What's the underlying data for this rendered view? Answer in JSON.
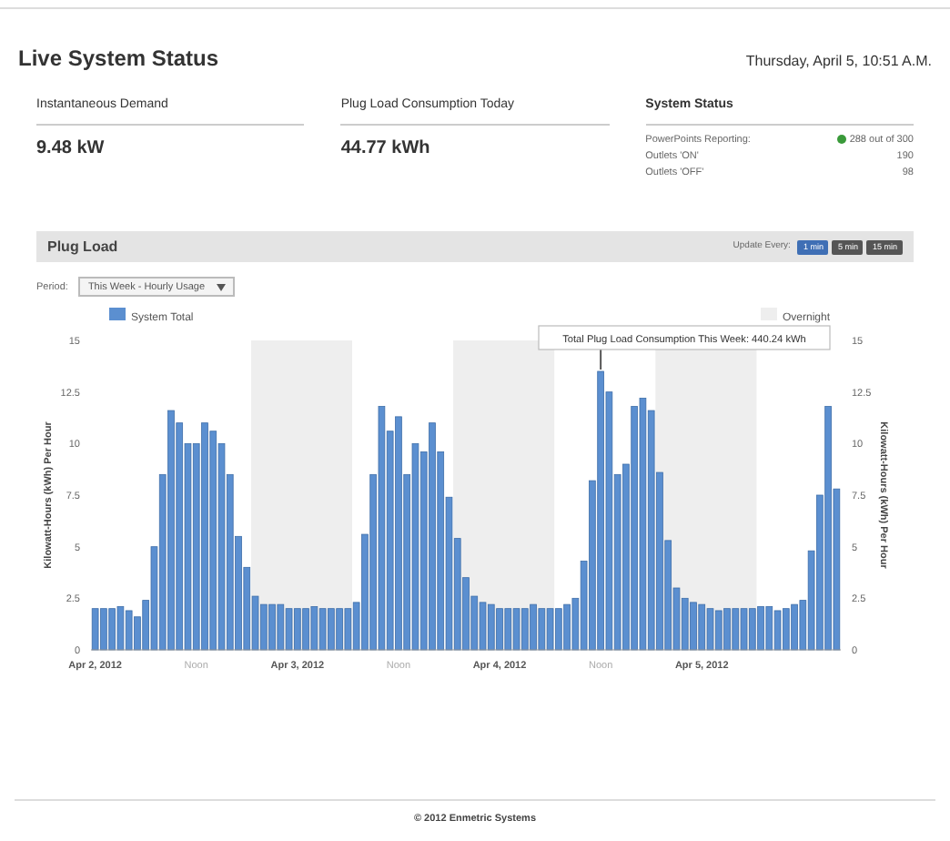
{
  "header": {
    "title": "Live System Status",
    "datetime": "Thursday, April 5, 10:51 A.M."
  },
  "summary": [
    {
      "label": "Instantaneous Demand",
      "value": "9.48 kW"
    },
    {
      "label": "Plug Load Consumption Today",
      "value": "44.77 kWh"
    }
  ],
  "system_status": {
    "label": "System Status",
    "rows": [
      {
        "label": "PowerPoints Reporting:",
        "value": "288 out of 300",
        "color": "#3a9a3a"
      },
      {
        "label": "Outlets 'ON'",
        "value": "190"
      },
      {
        "label": "Outlets 'OFF'",
        "value": "98"
      }
    ]
  },
  "panel": {
    "title": "Plug Load",
    "update_label": "Update Every:",
    "update_buttons": [
      {
        "label": "1 min",
        "selected": true
      },
      {
        "label": "5 min",
        "selected": false
      },
      {
        "label": "15 min",
        "selected": false
      }
    ],
    "period_label": "Period:",
    "period_value": "This Week - Hourly Usage",
    "legend": [
      {
        "label": "Overnight",
        "kind": "band",
        "color": "#eeeeee"
      }
    ],
    "tooltip": "Total Plug Load Consumption This Week: 440.24 kWh",
    "right_ylabel": "Kilowatt-Hours (kWh) Per Hour",
    "right_yticks": [
      "15",
      "12.5",
      "10",
      "7.5",
      "5",
      "2.5",
      "0"
    ],
    "chart_data": {
      "type": "bar",
      "ylabel": "Kilowatt-Hours (kWh) Per Hour",
      "categories": [
        "Apr 2, 2012",
        null,
        null,
        null,
        null,
        null,
        null,
        null,
        null,
        null,
        null,
        null,
        "Noon",
        null,
        null,
        null,
        null,
        null,
        null,
        null,
        null,
        null,
        null,
        null,
        "Apr 3, 2012",
        null,
        null,
        null,
        null,
        null,
        null,
        null,
        null,
        null,
        null,
        null,
        "Noon",
        null,
        null,
        null,
        null,
        null,
        null,
        null,
        null,
        null,
        null,
        null,
        "Apr 4, 2012",
        null,
        null,
        null,
        null,
        null,
        null,
        null,
        null,
        null,
        null,
        null,
        "Noon",
        null,
        null,
        null,
        null,
        null,
        null,
        null,
        null,
        null,
        null,
        null,
        "Apr 5, 2012",
        null,
        null,
        null,
        null,
        null,
        null,
        null,
        null,
        null,
        null,
        null,
        null,
        null,
        null,
        null,
        null
      ],
      "series": [
        {
          "name": "System Total",
          "color": "#5b8fd0",
          "values": [
            2,
            2,
            2,
            2.1,
            1.9,
            1.6,
            2.4,
            5,
            8.5,
            11.6,
            11,
            10,
            10,
            11,
            10.6,
            10,
            8.5,
            5.5,
            4,
            2.6,
            2.2,
            2.2,
            2.2,
            2,
            2,
            2,
            2.1,
            2,
            2,
            2,
            2,
            2.3,
            5.6,
            8.5,
            11.8,
            10.6,
            11.3,
            8.5,
            10,
            9.6,
            11,
            9.6,
            7.4,
            5.4,
            3.5,
            2.6,
            2.3,
            2.2,
            2,
            2,
            2,
            2,
            2.2,
            2,
            2,
            2,
            2.2,
            2.5,
            4.3,
            8.2,
            13.5,
            12.5,
            8.5,
            9,
            11.8,
            12.2,
            11.6,
            8.6,
            5.3,
            3,
            2.5,
            2.3,
            2.2,
            2,
            1.9,
            2,
            2,
            2,
            2,
            2.1,
            2.1,
            1.9,
            2,
            2.2,
            2.4,
            4.8,
            7.5,
            11.8,
            7.8
          ]
        }
      ],
      "ylim": [
        0,
        15
      ],
      "yticks": [
        0,
        {
          "value": 2.5,
          "label": "2.5"
        },
        5,
        {
          "value": 7.5,
          "label": "7.5"
        },
        10,
        {
          "value": 12.5,
          "label": "12.5"
        },
        15
      ]
    }
  },
  "footer": "© 2012 Enmetric Systems"
}
